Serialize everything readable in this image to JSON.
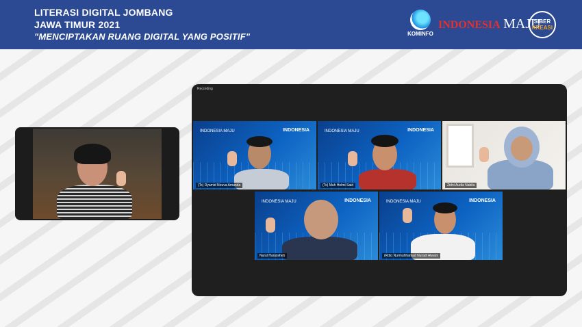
{
  "banner": {
    "line1": "LITERASI DIGITAL JOMBANG",
    "line2": "JAWA TIMUR 2021",
    "line3": "\"MENCIPTAKAN RUANG DIGITAL YANG POSITIF\"",
    "background": "#2c4a93"
  },
  "logos": {
    "kominfo": "KOMINFO",
    "indonesia": "INDONESIA",
    "maju": "MAJU",
    "siber": "SIBER",
    "kreasi": "KREASI"
  },
  "meeting": {
    "recording_label": "Recording",
    "tile_brand": "INDONESIA MAJU",
    "tile_indonesia": "INDONESIA",
    "participants": [
      {
        "name": "(Ts) Dyamid Nouva Amanda"
      },
      {
        "name": "(Ts) Muh Helmi Said"
      },
      {
        "name": "Zidni Audia Nabila"
      },
      {
        "name": "Nurul Hanjosheb"
      },
      {
        "name": "(Rds) Nurmuhhamad Nuradi Alwani"
      }
    ]
  }
}
